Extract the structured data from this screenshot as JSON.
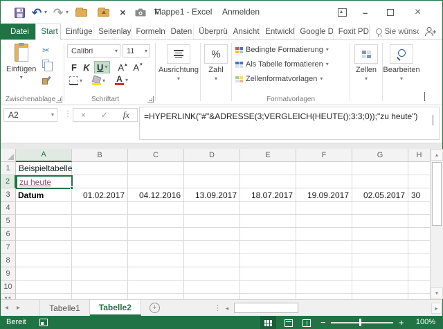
{
  "window": {
    "title": "Mappe1 - Excel",
    "signin": "Anmelden"
  },
  "icons": {
    "undo": "↶",
    "redo": "↷",
    "dropdown": "▾",
    "scissors": "✂",
    "cancel": "×",
    "check": "✓",
    "dots": "⋮",
    "close_x": "×",
    "minimize": "–",
    "left": "◂",
    "right": "▸",
    "up": "▴",
    "down": "▾",
    "plus": "+",
    "minus": "−",
    "percent": "%"
  },
  "ribbon": {
    "tabs": [
      {
        "label": "Datei"
      },
      {
        "label": "Start"
      },
      {
        "label": "Einfüge"
      },
      {
        "label": "Seitenlay"
      },
      {
        "label": "Formeln"
      },
      {
        "label": "Daten"
      },
      {
        "label": "Überprü"
      },
      {
        "label": "Ansicht"
      },
      {
        "label": "Entwickl"
      },
      {
        "label": "Google D"
      },
      {
        "label": "Foxit PD"
      }
    ],
    "tell_me": "Sie wünsc",
    "clipboard": {
      "paste": "Einfügen",
      "group": "Zwischenablage"
    },
    "font": {
      "name": "Calibri",
      "size": "11",
      "bold": "F",
      "italic": "K",
      "underline": "U",
      "grow": "A",
      "shrink": "A",
      "color_letter": "A",
      "group": "Schriftart"
    },
    "alignment": {
      "label": "Ausrichtung"
    },
    "number": {
      "label": "Zahl"
    },
    "styles": {
      "conditional": "Bedingte Formatierung",
      "as_table": "Als Tabelle formatieren",
      "cell_styles": "Zellenformatvorlagen",
      "group": "Formatvorlagen"
    },
    "cells": {
      "label": "Zellen"
    },
    "editing": {
      "label": "Bearbeiten"
    }
  },
  "formula_bar": {
    "cell_ref": "A2",
    "fx": "fx",
    "formula": "=HYPERLINK(\"#\"&ADRESSE(3;VERGLEICH(HEUTE();3:3;0));\"zu heute\")"
  },
  "sheet": {
    "columns": [
      "A",
      "B",
      "C",
      "D",
      "E",
      "F",
      "G",
      "H"
    ],
    "rows": [
      "1",
      "2",
      "3",
      "4",
      "5",
      "6",
      "7",
      "8",
      "9",
      "10",
      "11"
    ],
    "a1": "Beispieltabelle",
    "a2": "zu heute",
    "a3": "Datum",
    "dates": [
      "01.02.2017",
      "04.12.2016",
      "13.09.2017",
      "18.07.2017",
      "19.09.2017",
      "02.05.2017",
      "30"
    ]
  },
  "sheet_tabs": {
    "sheet1": "Tabelle1",
    "sheet2": "Tabelle2"
  },
  "status_bar": {
    "ready": "Bereit",
    "zoom": "100%"
  },
  "colors": {
    "accent_green": "#217346",
    "hyperlink_visited": "#954F72"
  }
}
